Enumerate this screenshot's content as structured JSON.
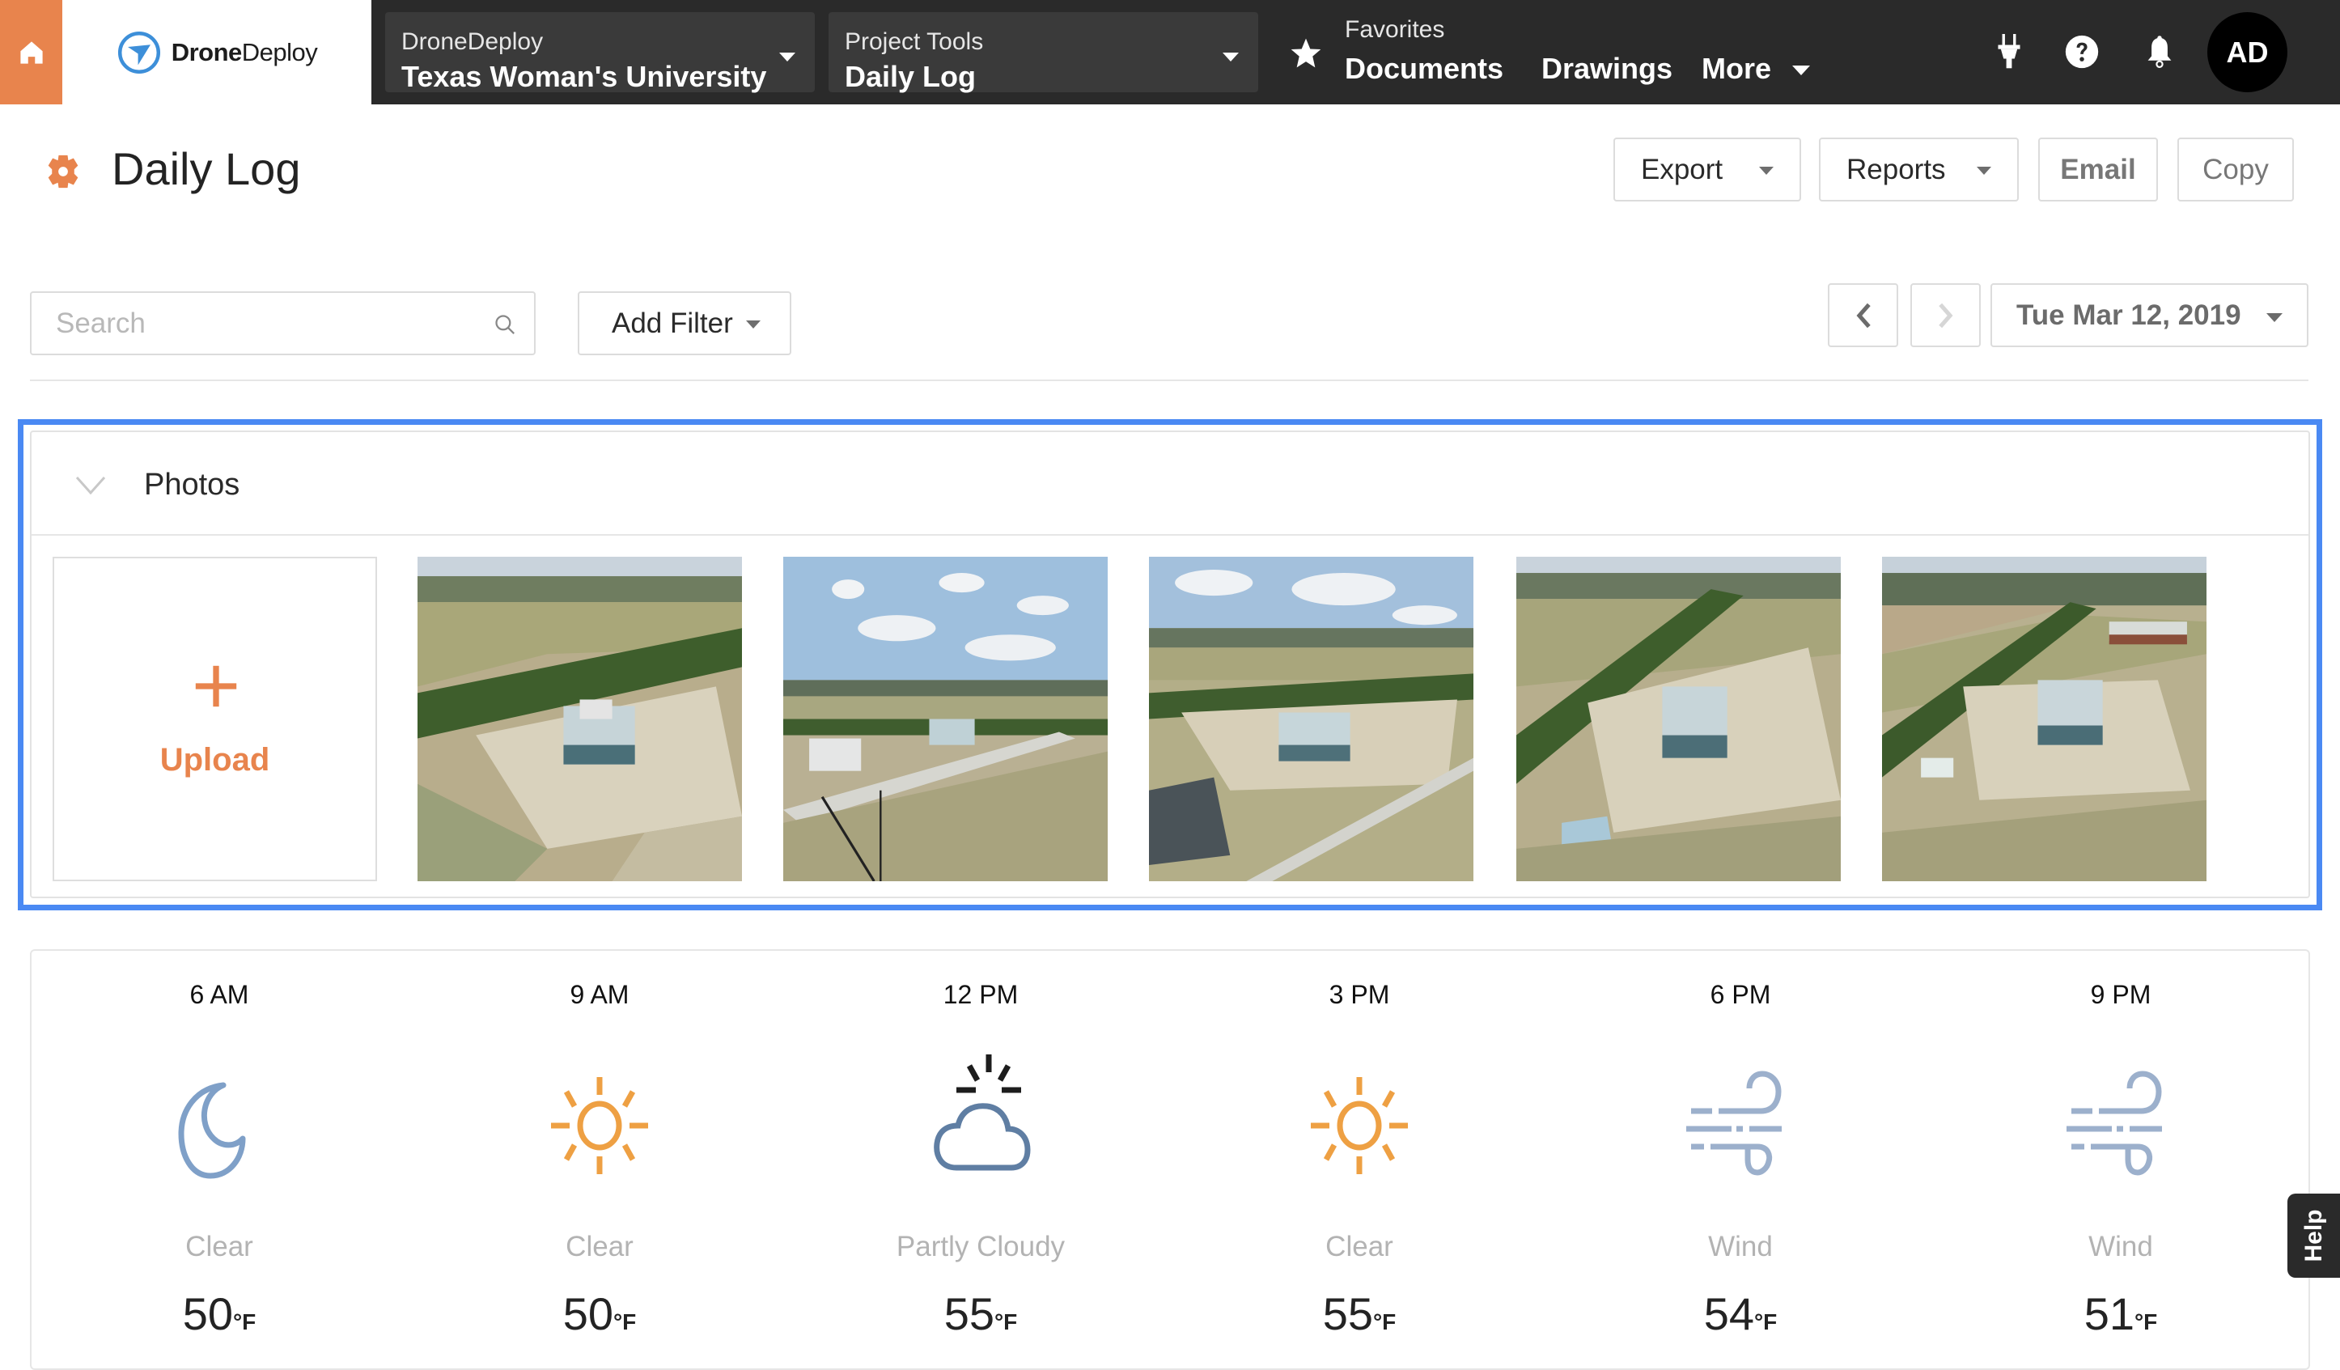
{
  "topbar": {
    "logo_bold": "Drone",
    "logo_regular": "Deploy",
    "project_dropdown": {
      "label": "DroneDeploy",
      "value": "Texas Woman's University"
    },
    "tools_dropdown": {
      "label": "Project Tools",
      "value": "Daily Log"
    },
    "favorites": {
      "label": "Favorites",
      "value": "Documents"
    },
    "links": [
      "Drawings",
      "More"
    ],
    "avatar_initials": "AD"
  },
  "header": {
    "title": "Daily Log",
    "buttons": {
      "export": "Export",
      "reports": "Reports",
      "email": "Email",
      "copy": "Copy"
    }
  },
  "filters": {
    "search_placeholder": "Search",
    "search_value": "",
    "add_filter": "Add Filter",
    "date": "Tue Mar 12, 2019"
  },
  "photos": {
    "title": "Photos",
    "upload_label": "Upload",
    "items": [
      {
        "description": "Aerial view of construction site with building"
      },
      {
        "description": "Aerial view with cloudy sky and field"
      },
      {
        "description": "Aerial view of building and road"
      },
      {
        "description": "Aerial view of construction site from above"
      },
      {
        "description": "Aerial view of site with nearby school"
      }
    ]
  },
  "weather": [
    {
      "time": "6 AM",
      "icon": "moon-icon",
      "condition": "Clear",
      "temp": "50",
      "unit": "°F"
    },
    {
      "time": "9 AM",
      "icon": "sun-icon",
      "condition": "Clear",
      "temp": "50",
      "unit": "°F"
    },
    {
      "time": "12 PM",
      "icon": "partly-cloudy-icon",
      "condition": "Partly Cloudy",
      "temp": "55",
      "unit": "°F"
    },
    {
      "time": "3 PM",
      "icon": "sun-icon",
      "condition": "Clear",
      "temp": "55",
      "unit": "°F"
    },
    {
      "time": "6 PM",
      "icon": "wind-icon",
      "condition": "Wind",
      "temp": "54",
      "unit": "°F"
    },
    {
      "time": "9 PM",
      "icon": "wind-icon",
      "condition": "Wind",
      "temp": "51",
      "unit": "°F"
    }
  ],
  "help_tab": "Help",
  "colors": {
    "accent_orange": "#e8844d",
    "highlight_blue": "#4a89f3",
    "topbar": "#2a2a2a",
    "moon": "#7fa0c8",
    "sun": "#eea043",
    "cloud": "#5f7ea3",
    "wind": "#9cb0cc"
  }
}
